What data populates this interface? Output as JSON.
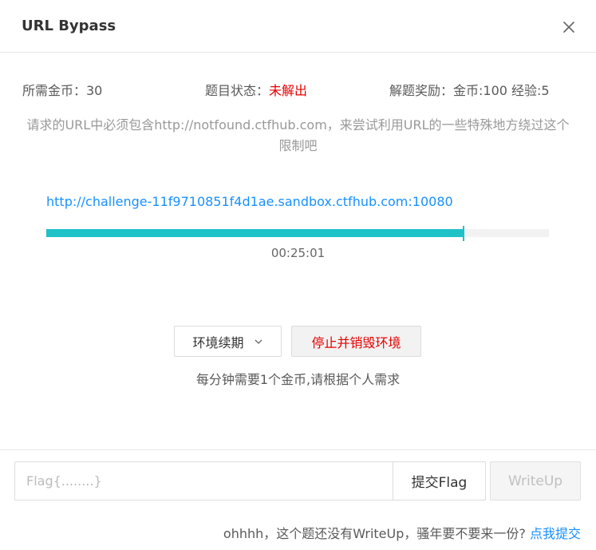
{
  "dialog": {
    "title": "URL Bypass",
    "close_icon": "close-icon"
  },
  "info": {
    "cost": "所需金币：30",
    "status_label": "题目状态：",
    "status_value": "未解出",
    "reward": "解题奖励：金币:100 经验:5"
  },
  "description": "请求的URL中必须包含http://notfound.ctfhub.com，来尝试利用URL的一些特殊地方绕过这个限制吧",
  "challenge": {
    "url": "http://challenge-11f9710851f4d1ae.sandbox.ctfhub.com:10080",
    "progress": 0.83,
    "timer": "00:25:01"
  },
  "actions": {
    "renew_label": "环境续期",
    "renew_icon": "chevron-down-icon",
    "stop_label": "停止并销毁环境",
    "note": "每分钟需要1个金币,请根据个人需求"
  },
  "flag": {
    "placeholder": "Flag{........}",
    "value": "",
    "submit_label": "提交Flag",
    "writeup_label": "WriteUp"
  },
  "footer": {
    "text": "ohhhh，这个题还没有WriteUp，骚年要不要来一份?",
    "link": "点我提交"
  },
  "colors": {
    "accent": "#1ec2c7",
    "link": "#1890ff",
    "danger": "#e60000"
  }
}
